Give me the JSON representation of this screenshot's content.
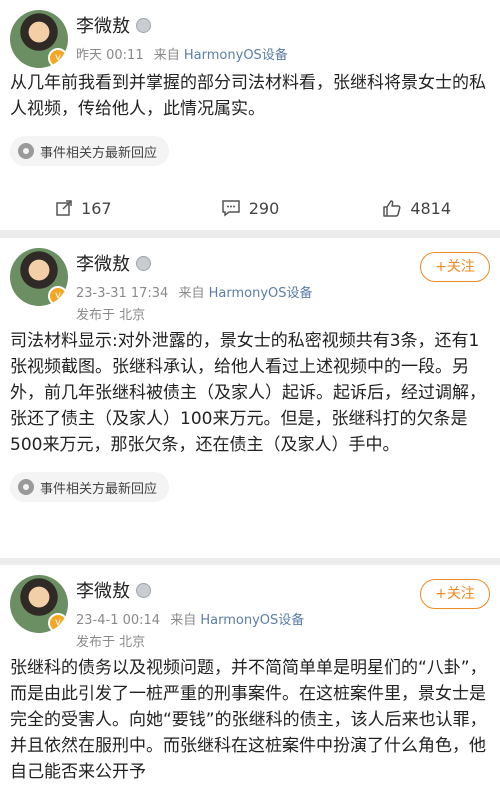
{
  "posts": [
    {
      "author": "李微敖",
      "time": "昨天 00:11",
      "source_prefix": "来自",
      "device": "HarmonyOS设备",
      "location": "",
      "follow_label": "",
      "text": "从几年前我看到并掌握的部分司法材料看，张继科将景女士的私人视频，传给他人，此情况属实。",
      "chip": "事件相关方最新回应",
      "reposts": "167",
      "comments": "290",
      "likes": "4814"
    },
    {
      "author": "李微敖",
      "time": "23-3-31 17:34",
      "source_prefix": "来自",
      "device": "HarmonyOS设备",
      "location": "发布于 北京",
      "follow_label": "+关注",
      "text": "司法材料显示:对外泄露的，景女士的私密视频共有3条，还有1张视频截图。张继科承认，给他人看过上述视频中的一段。另外，前几年张继科被债主（及家人）起诉。起诉后，经过调解，张还了债主（及家人）100来万元。但是，张继科打的欠条是500来万元，那张欠条，还在债主（及家人）手中。",
      "chip": "事件相关方最新回应"
    },
    {
      "author": "李微敖",
      "time": "23-4-1 00:14",
      "source_prefix": "来自",
      "device": "HarmonyOS设备",
      "location": "发布于 北京",
      "follow_label": "+关注",
      "text": "张继科的债务以及视频问题，并不简简单单是明星们的“八卦”，而是由此引发了一桩严重的刑事案件。在这桩案件里，景女士是完全的受害人。向她“要钱”的张继科的债主，该人后来也认罪，并且依然在服刑中。而张继科在这桩案件中扮演了什么角色，他自己能否来公开予"
    }
  ],
  "colors": {
    "follow": "#f08a24",
    "device_link": "#5b7da8",
    "vip": "#f5a623"
  }
}
